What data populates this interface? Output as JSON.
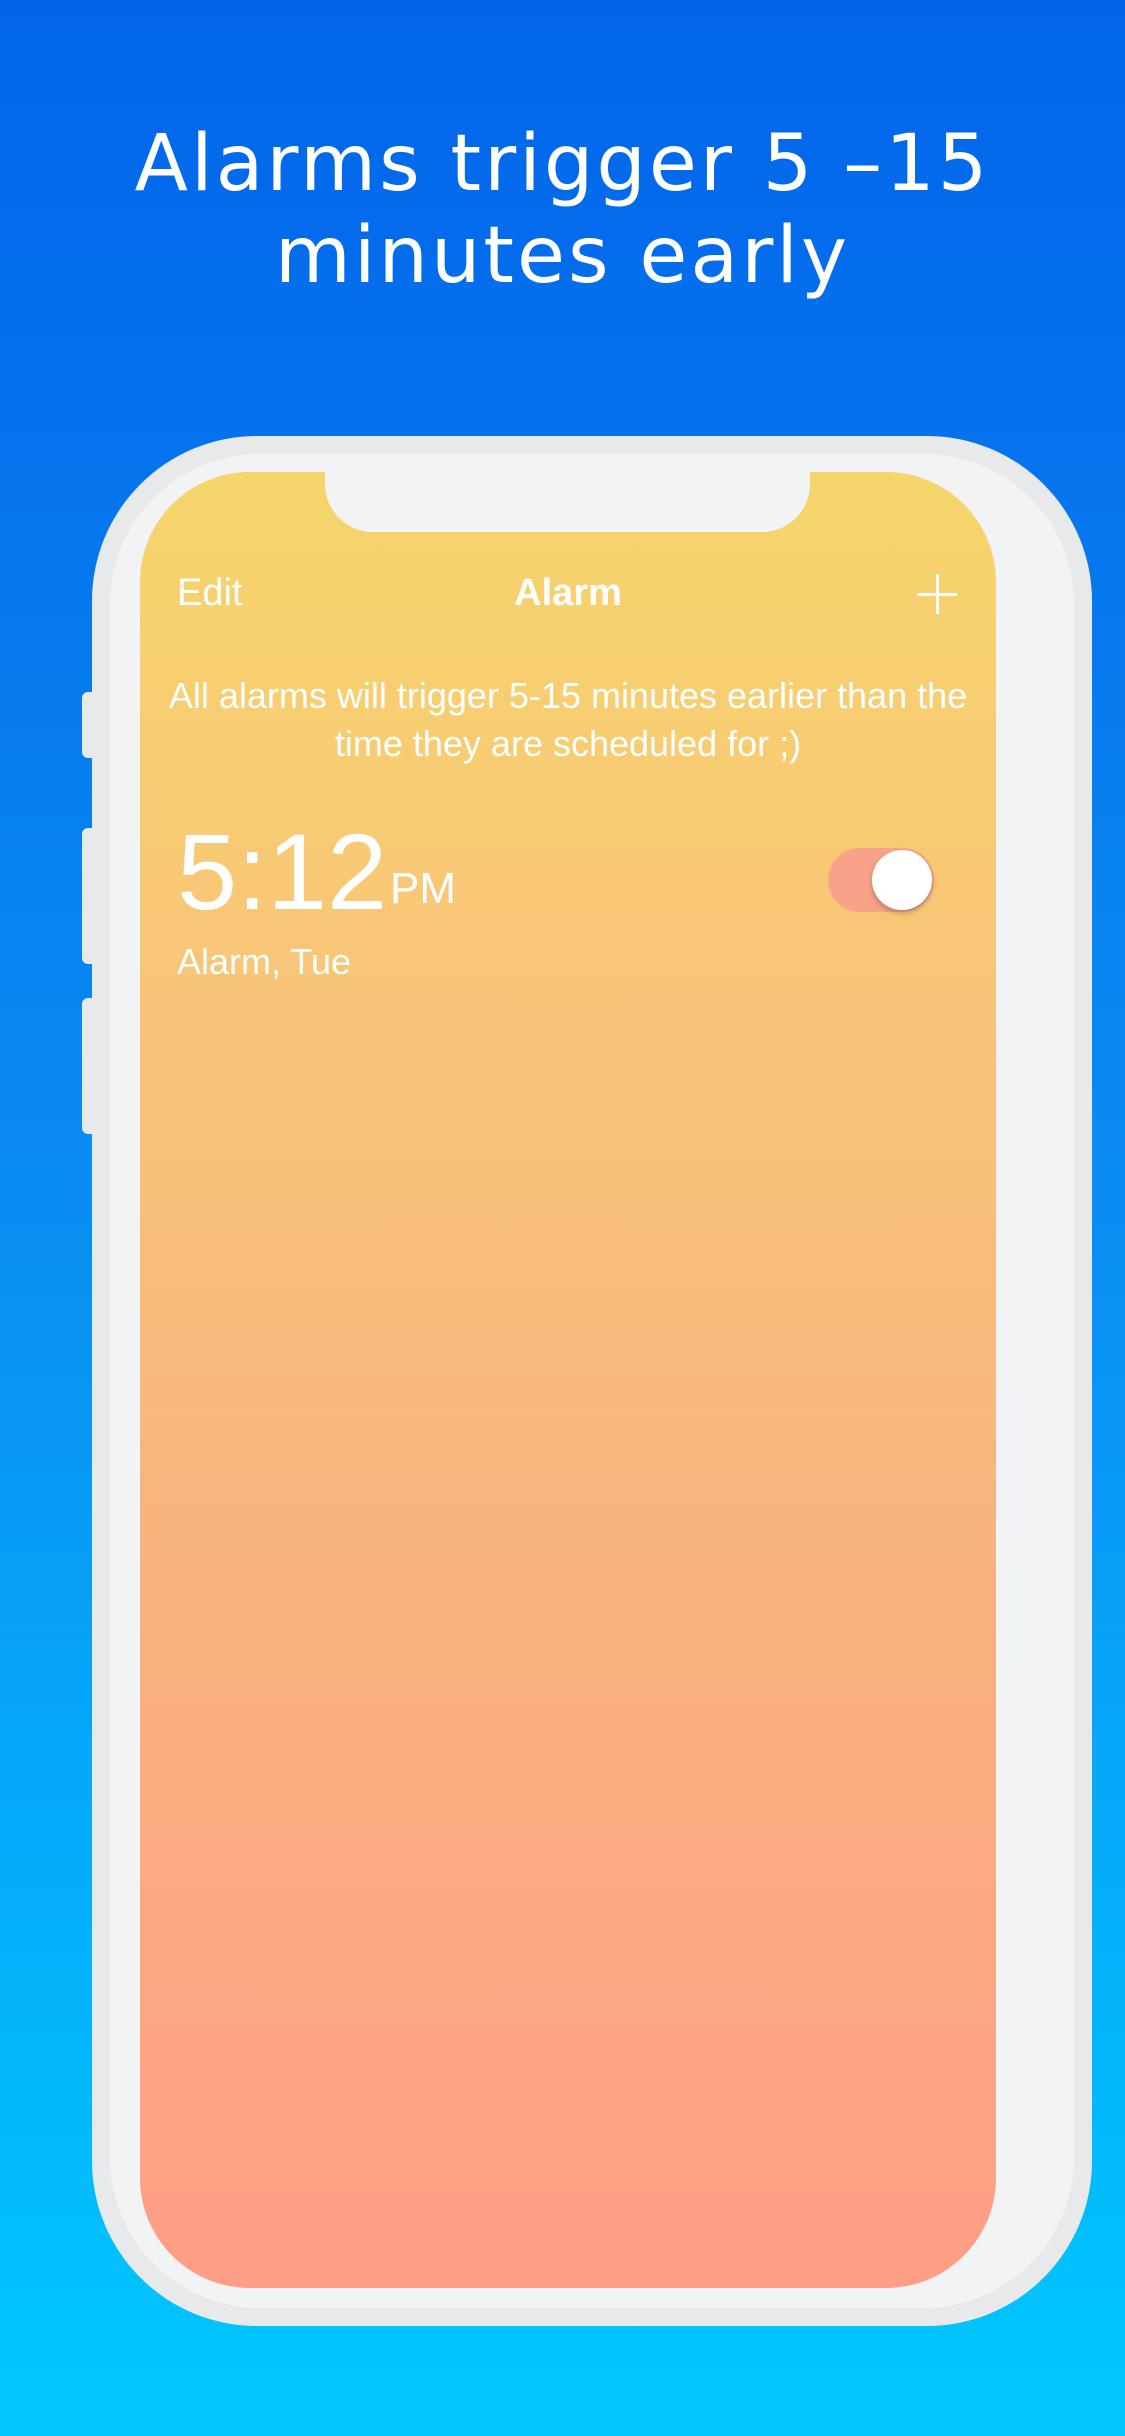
{
  "headline": {
    "line1": "Alarms trigger 5 –15",
    "line2": "minutes early"
  },
  "nav": {
    "edit_label": "Edit",
    "title": "Alarm",
    "add_icon": "plus-icon"
  },
  "notice": "All alarms will trigger 5-15 minutes earlier than the time they are scheduled for ;)",
  "alarms": [
    {
      "time": "5:12",
      "ampm": "PM",
      "label": "Alarm, Tue",
      "enabled": true
    }
  ],
  "colors": {
    "background_top": "#0264EA",
    "background_bottom": "#00C8FF",
    "screen_top": "#F6D56B",
    "screen_bottom": "#FF9E86",
    "toggle_on": "#F8A389"
  }
}
